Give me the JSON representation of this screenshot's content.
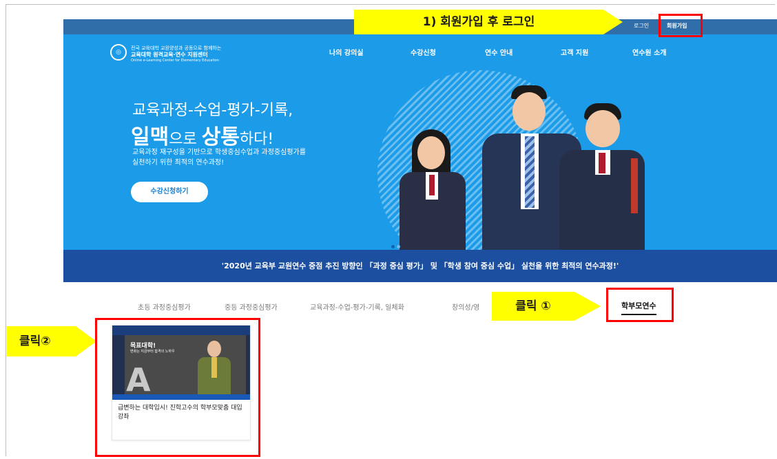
{
  "top_links": {
    "login": "로그인",
    "signup": "회원가입"
  },
  "brand": {
    "logo_line1": "전국 교육대학 교원양성과 공동으로 함께하는",
    "logo_line2": "교육대학 원격교육·연수 지원센터",
    "logo_line3": "Online e-Learning Center for Elementary Education"
  },
  "nav": [
    "나의 강의실",
    "수강신청",
    "연수 안내",
    "고객 지원",
    "연수원 소개"
  ],
  "hero": {
    "title_line1": "교육과정-수업-평가-기록,",
    "title_big1": "일맥",
    "title_small1": "으로 ",
    "title_big2": "상통",
    "title_small2": "하다!",
    "sub_line1": "교육과정 재구성을 기반으로 학생중심수업과 과정중심평가를",
    "sub_line2": "실천하기 위한 최적의 연수과정!",
    "cta_label": "수강신청하기",
    "banner": "'2020년 교육부 교원연수 중점 추진 방향인 「과정 중심 평가」 및 「학생 참여 중심 수업」 실천을 위한 최적의 연수과정!'"
  },
  "tabs": {
    "items": [
      "초등 과정중심평가",
      "중등 과정중심평가",
      "교육과정-수업-평가-기록, 일체화",
      "창의성/영"
    ],
    "active": "학부모연수"
  },
  "annotations": {
    "step1": "1) 회원가입 후 로그인",
    "click1": "클릭 ①",
    "click2": "클릭②"
  },
  "course": {
    "thumb_title": "목표대학!",
    "thumb_sub": "변화는 지금부터 합격의 노하우",
    "title": "급변하는 대학입시! 진학고수의 학부모맞춤 대입강좌"
  },
  "colors": {
    "hero_bg": "#1b9be8",
    "banner_bg": "#1c4fa0",
    "callout": "#ffff00",
    "highlight_border": "#ff0000"
  }
}
